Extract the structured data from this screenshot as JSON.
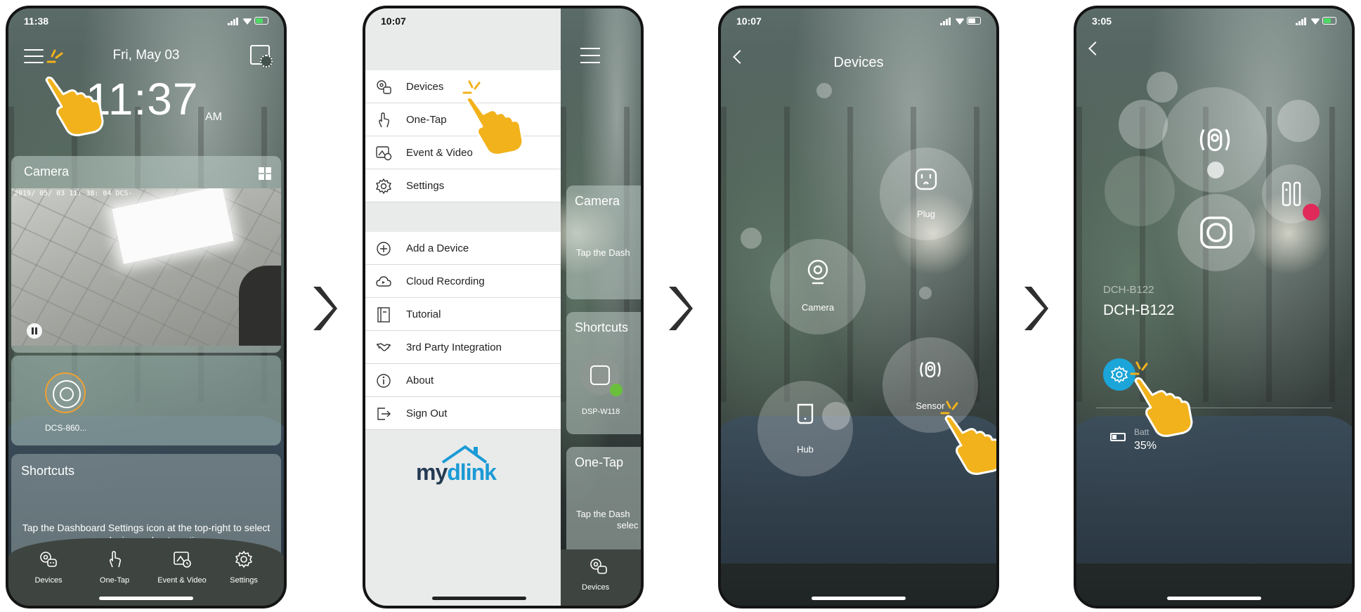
{
  "colors": {
    "hand": "#f2b21b",
    "accent_blue": "#1ba5d8",
    "brand_dark": "#243a52",
    "brand_blue": "#1b9ad6",
    "power_on": "#6bc03b",
    "device_ring": "#f0a030",
    "alert_badge": "#e02a5a"
  },
  "screen1": {
    "status_time": "11:38",
    "date": "Fri, May 03",
    "clock_time": "11:37",
    "clock_ampm": "AM",
    "camera_card_title": "Camera",
    "camera_timestamp": "2019/ 05/ 03  11: 38: 04   DCS-",
    "device_label": "DCS-860...",
    "shortcuts_title": "Shortcuts",
    "shortcuts_text": "Tap the Dashboard Settings icon at the top-right to select your device and automation.",
    "tabs": [
      {
        "label": "Devices",
        "icon": "devices-icon"
      },
      {
        "label": "One-Tap",
        "icon": "one-tap-icon"
      },
      {
        "label": "Event & Video",
        "icon": "event-video-icon"
      },
      {
        "label": "Settings",
        "icon": "settings-gear-icon"
      }
    ]
  },
  "screen2": {
    "status_time": "10:07",
    "menu_primary": [
      {
        "label": "Devices",
        "icon": "devices-icon"
      },
      {
        "label": "One-Tap",
        "icon": "one-tap-icon"
      },
      {
        "label": "Event & Video",
        "icon": "event-video-icon"
      },
      {
        "label": "Settings",
        "icon": "settings-gear-icon"
      }
    ],
    "menu_secondary": [
      {
        "label": "Add a Device",
        "icon": "add-circle-icon"
      },
      {
        "label": "Cloud Recording",
        "icon": "cloud-icon"
      },
      {
        "label": "Tutorial",
        "icon": "book-icon"
      },
      {
        "label": "3rd Party Integration",
        "icon": "handshake-icon"
      },
      {
        "label": "About",
        "icon": "info-icon"
      },
      {
        "label": "Sign Out",
        "icon": "sign-out-icon"
      }
    ],
    "logo_text_a": "my",
    "logo_text_b": "dlink",
    "behind_camera_title": "Camera",
    "behind_camera_text": "Tap the Dash",
    "behind_shortcuts_title": "Shortcuts",
    "behind_plug_label": "DSP-W118",
    "behind_onetap_title": "One-Tap",
    "behind_onetap_text": "Tap the Dash",
    "behind_onetap_text2": "selec",
    "behind_tab_label": "Devices"
  },
  "screen3": {
    "status_time": "10:07",
    "title": "Devices",
    "bubbles": [
      {
        "label": "Plug",
        "icon": "plug-icon"
      },
      {
        "label": "Camera",
        "icon": "camera-icon"
      },
      {
        "label": "Sensor",
        "icon": "sensor-icon"
      },
      {
        "label": "Hub",
        "icon": "hub-icon"
      }
    ]
  },
  "screen4": {
    "status_time": "3:05",
    "device_model_sub": "DCH-B122",
    "device_name": "DCH-B122",
    "battery_label": "Batt",
    "battery_value": "35%"
  }
}
